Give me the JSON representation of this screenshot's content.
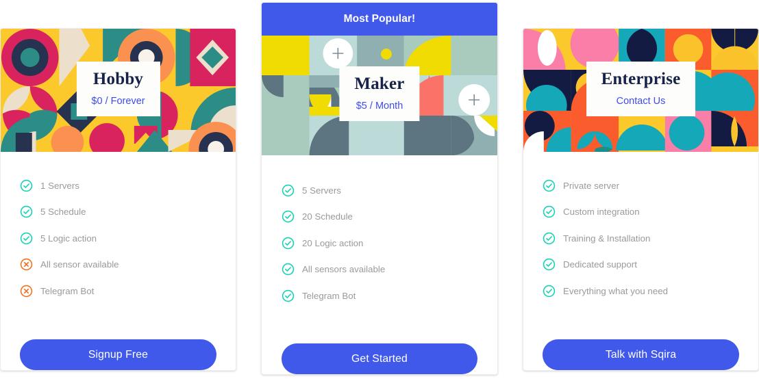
{
  "page": {
    "accent_blue": "#4159eb",
    "check_color": "#16d2b5",
    "cross_color": "#f2711c",
    "label_color": "#9a9a9a",
    "title_color": "#162247"
  },
  "plans": [
    {
      "name": "Hobby",
      "price": "$0 / Forever",
      "banner": null,
      "cta_label": "Signup Free",
      "features": [
        {
          "label": "1 Servers",
          "icon": "check-circle-icon",
          "included": true
        },
        {
          "label": "5 Schedule",
          "icon": "check-circle-icon",
          "included": true
        },
        {
          "label": "5 Logic action",
          "icon": "check-circle-icon",
          "included": true
        },
        {
          "label": "All sensor available",
          "icon": "cross-circle-icon",
          "included": false
        },
        {
          "label": "Telegram Bot",
          "icon": "cross-circle-icon",
          "included": false
        }
      ]
    },
    {
      "name": "Maker",
      "price": "$5 / Month",
      "banner": "Most Popular!",
      "cta_label": "Get Started",
      "features": [
        {
          "label": "5 Servers",
          "icon": "check-circle-icon",
          "included": true
        },
        {
          "label": "20 Schedule",
          "icon": "check-circle-icon",
          "included": true
        },
        {
          "label": "20 Logic action",
          "icon": "check-circle-icon",
          "included": true
        },
        {
          "label": "All sensors available",
          "icon": "check-circle-icon",
          "included": true
        },
        {
          "label": "Telegram Bot",
          "icon": "check-circle-icon",
          "included": true
        }
      ]
    },
    {
      "name": "Enterprise",
      "price": "Contact Us",
      "banner": null,
      "cta_label": "Talk with Sqira",
      "features": [
        {
          "label": "Private server",
          "icon": "check-circle-icon",
          "included": true
        },
        {
          "label": "Custom integration",
          "icon": "check-circle-icon",
          "included": true
        },
        {
          "label": "Training & Installation",
          "icon": "check-circle-icon",
          "included": true
        },
        {
          "label": "Dedicated support",
          "icon": "check-circle-icon",
          "included": true
        },
        {
          "label": "Everything what you need",
          "icon": "check-circle-icon",
          "included": true
        }
      ]
    }
  ]
}
